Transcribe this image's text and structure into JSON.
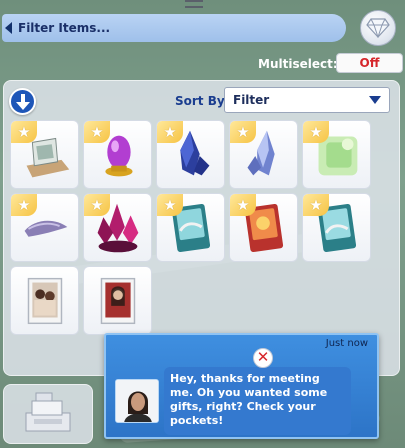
{
  "filter": {
    "label": "Filter Items...",
    "back_icon": "left-triangle-icon",
    "gem_icon": "diamond-icon"
  },
  "multiselect": {
    "label": "Multiselect:",
    "value": "Off",
    "value_color": "#d6262b"
  },
  "sort": {
    "label": "Sort By:",
    "selected": "Filter",
    "order_icon": "down-arrow-icon"
  },
  "inventory": {
    "items": [
      {
        "name": "tile-rock-crystal-slab",
        "starred": true
      },
      {
        "name": "tile-purple-egg",
        "starred": true
      },
      {
        "name": "tile-blue-crystal",
        "starred": true
      },
      {
        "name": "tile-light-blue-crystal",
        "starred": true
      },
      {
        "name": "tile-green-cube",
        "starred": true
      },
      {
        "name": "tile-purple-stone",
        "starred": true
      },
      {
        "name": "tile-pink-crystal-cluster",
        "starred": true
      },
      {
        "name": "tile-card-teal",
        "starred": true
      },
      {
        "name": "tile-card-red",
        "starred": true
      },
      {
        "name": "tile-card-teal-2",
        "starred": true
      },
      {
        "name": "tile-photo-couple",
        "starred": false
      },
      {
        "name": "tile-photo-portrait",
        "starred": false
      }
    ]
  },
  "notification": {
    "time": "Just now",
    "message": "Hey, thanks for meeting me. Oh you wanted some gifts, right? Check your pockets!",
    "close_icon": "close-icon",
    "avatar_icon": "sim-avatar"
  },
  "colors": {
    "accent": "#1e56b8",
    "notification": "#2d74c7",
    "star": "#f6c344"
  }
}
